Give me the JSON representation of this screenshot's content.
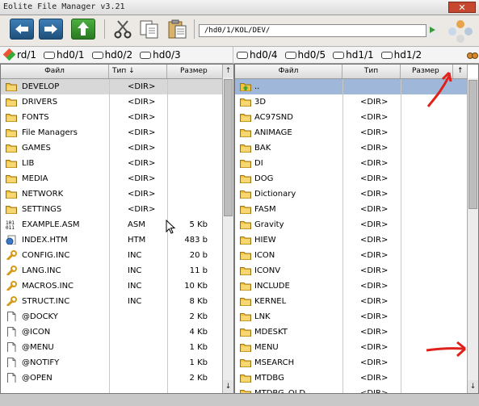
{
  "window": {
    "title": "Eolite File Manager v3.21",
    "close_glyph": "✕"
  },
  "toolbar": {
    "buttons": [
      {
        "name": "back-button",
        "icon": "arrow-left-icon"
      },
      {
        "name": "forward-button",
        "icon": "arrow-right-icon"
      },
      {
        "name": "up-button",
        "icon": "arrow-up-icon"
      },
      {
        "name": "cut-button",
        "icon": "scissors-icon"
      },
      {
        "name": "copy-button",
        "icon": "copy-icon"
      },
      {
        "name": "paste-button",
        "icon": "paste-icon"
      }
    ],
    "path": "/hd0/1/KOL/DEV/"
  },
  "drives_left": [
    "rd/1",
    "hd0/1",
    "hd0/2",
    "hd0/3"
  ],
  "drives_right": [
    "hd0/4",
    "hd0/5",
    "hd1/1",
    "hd1/2"
  ],
  "left_panel": {
    "headers": {
      "name": "Файл",
      "type": "Тип",
      "sort_glyph": "↓",
      "size": "Размер",
      "up": "↑"
    },
    "rows": [
      {
        "name": "DEVELOP",
        "type": "<DIR>",
        "size": "",
        "icon": "folder-icon",
        "selected": true
      },
      {
        "name": "DRIVERS",
        "type": "<DIR>",
        "size": "",
        "icon": "folder-icon"
      },
      {
        "name": "FONTS",
        "type": "<DIR>",
        "size": "",
        "icon": "folder-icon"
      },
      {
        "name": "File Managers",
        "type": "<DIR>",
        "size": "",
        "icon": "folder-icon"
      },
      {
        "name": "GAMES",
        "type": "<DIR>",
        "size": "",
        "icon": "folder-icon"
      },
      {
        "name": "LIB",
        "type": "<DIR>",
        "size": "",
        "icon": "folder-icon"
      },
      {
        "name": "MEDIA",
        "type": "<DIR>",
        "size": "",
        "icon": "folder-icon"
      },
      {
        "name": "NETWORK",
        "type": "<DIR>",
        "size": "",
        "icon": "folder-icon"
      },
      {
        "name": "SETTINGS",
        "type": "<DIR>",
        "size": "",
        "icon": "folder-icon"
      },
      {
        "name": "EXAMPLE.ASM",
        "type": "ASM",
        "size": "5 Kb",
        "icon": "binary-file-icon"
      },
      {
        "name": "INDEX.HTM",
        "type": "HTM",
        "size": "483 b",
        "icon": "html-file-icon"
      },
      {
        "name": "CONFIG.INC",
        "type": "INC",
        "size": "20 b",
        "icon": "wrench-file-icon"
      },
      {
        "name": "LANG.INC",
        "type": "INC",
        "size": "11 b",
        "icon": "wrench-file-icon"
      },
      {
        "name": "MACROS.INC",
        "type": "INC",
        "size": "10 Kb",
        "icon": "wrench-file-icon"
      },
      {
        "name": "STRUCT.INC",
        "type": "INC",
        "size": "8 Kb",
        "icon": "wrench-file-icon"
      },
      {
        "name": "@DOCKY",
        "type": "",
        "size": "2 Kb",
        "icon": "file-icon"
      },
      {
        "name": "@ICON",
        "type": "",
        "size": "4 Kb",
        "icon": "file-icon"
      },
      {
        "name": "@MENU",
        "type": "",
        "size": "1 Kb",
        "icon": "file-icon"
      },
      {
        "name": "@NOTIFY",
        "type": "",
        "size": "1 Kb",
        "icon": "file-icon"
      },
      {
        "name": "@OPEN",
        "type": "",
        "size": "2 Kb",
        "icon": "file-icon"
      }
    ],
    "scroll": {
      "up": "↑",
      "down": "↓"
    }
  },
  "right_panel": {
    "headers": {
      "name": "Файл",
      "type": "Тип",
      "size": "Размер",
      "up": "↑"
    },
    "rows": [
      {
        "name": "..",
        "type": "",
        "size": "",
        "icon": "parent-folder-icon",
        "selected": true
      },
      {
        "name": "3D",
        "type": "<DIR>",
        "size": "",
        "icon": "folder-icon"
      },
      {
        "name": "AC97SND",
        "type": "<DIR>",
        "size": "",
        "icon": "folder-icon"
      },
      {
        "name": "ANIMAGE",
        "type": "<DIR>",
        "size": "",
        "icon": "folder-icon"
      },
      {
        "name": "BAK",
        "type": "<DIR>",
        "size": "",
        "icon": "folder-icon"
      },
      {
        "name": "DI",
        "type": "<DIR>",
        "size": "",
        "icon": "folder-icon"
      },
      {
        "name": "DOG",
        "type": "<DIR>",
        "size": "",
        "icon": "folder-icon"
      },
      {
        "name": "Dictionary",
        "type": "<DIR>",
        "size": "",
        "icon": "folder-icon"
      },
      {
        "name": "FASM",
        "type": "<DIR>",
        "size": "",
        "icon": "folder-icon"
      },
      {
        "name": "Gravity",
        "type": "<DIR>",
        "size": "",
        "icon": "folder-icon"
      },
      {
        "name": "HIEW",
        "type": "<DIR>",
        "size": "",
        "icon": "folder-icon"
      },
      {
        "name": "ICON",
        "type": "<DIR>",
        "size": "",
        "icon": "folder-icon"
      },
      {
        "name": "ICONV",
        "type": "<DIR>",
        "size": "",
        "icon": "folder-icon"
      },
      {
        "name": "INCLUDE",
        "type": "<DIR>",
        "size": "",
        "icon": "folder-icon"
      },
      {
        "name": "KERNEL",
        "type": "<DIR>",
        "size": "",
        "icon": "folder-icon"
      },
      {
        "name": "LNK",
        "type": "<DIR>",
        "size": "",
        "icon": "folder-icon"
      },
      {
        "name": "MDESKT",
        "type": "<DIR>",
        "size": "",
        "icon": "folder-icon"
      },
      {
        "name": "MENU",
        "type": "<DIR>",
        "size": "",
        "icon": "folder-icon"
      },
      {
        "name": "MSEARCH",
        "type": "<DIR>",
        "size": "",
        "icon": "folder-icon"
      },
      {
        "name": "MTDBG",
        "type": "<DIR>",
        "size": "",
        "icon": "folder-icon"
      },
      {
        "name": "MTDBG_OLD",
        "type": "<DIR>",
        "size": "",
        "icon": "folder-icon"
      }
    ],
    "scroll": {
      "up": "↑",
      "down": "↓"
    }
  },
  "colors": {
    "folder": "#f2c23a",
    "selection_gray": "#d8d8d8",
    "selection_blue": "#9fb7d8",
    "annotation_red": "#e0201a"
  }
}
